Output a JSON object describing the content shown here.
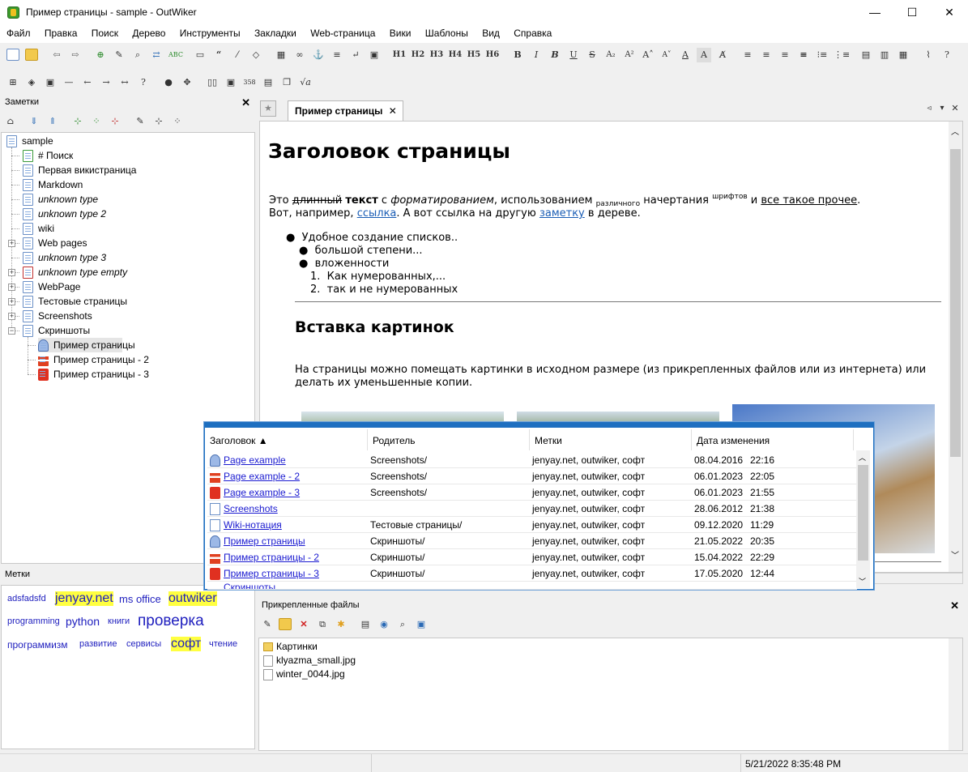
{
  "window": {
    "title": "Пример страницы - sample - OutWiker",
    "minimize": "—",
    "maximize": "☐",
    "close": "✕"
  },
  "menu": [
    "Файл",
    "Правка",
    "Поиск",
    "Дерево",
    "Инструменты",
    "Закладки",
    "Web-страница",
    "Вики",
    "Шаблоны",
    "Вид",
    "Справка"
  ],
  "toolbar": {
    "headings": [
      "H1",
      "H2",
      "H3",
      "H4",
      "H5",
      "H6"
    ],
    "sqrt": "√a"
  },
  "notes_panel": {
    "title": "Заметки",
    "root": "sample",
    "items": [
      {
        "label": "# Поиск",
        "italic": false
      },
      {
        "label": "Первая викистраница",
        "italic": false
      },
      {
        "label": "Markdown",
        "italic": false
      },
      {
        "label": "unknown type",
        "italic": true
      },
      {
        "label": "unknown type 2",
        "italic": true
      },
      {
        "label": "wiki",
        "italic": false
      },
      {
        "label": "Web pages",
        "italic": false
      },
      {
        "label": "unknown type 3",
        "italic": true
      },
      {
        "label": "unknown type empty",
        "italic": true
      },
      {
        "label": "WebPage",
        "italic": false
      },
      {
        "label": "Тестовые страницы",
        "italic": false
      },
      {
        "label": "Screenshots",
        "italic": false
      },
      {
        "label": "Скриншоты",
        "italic": false
      }
    ],
    "children": [
      "Пример страницы",
      "Пример страницы - 2",
      "Пример страницы - 3"
    ]
  },
  "tags_panel": {
    "title": "Метки",
    "tags": [
      "adsfadsfd",
      "jenyay.net",
      "ms office",
      "outwiker",
      "programming",
      "python",
      "книги",
      "проверка",
      "программизм",
      "развитие",
      "сервисы",
      "софт",
      "чтение"
    ]
  },
  "editor": {
    "tab_label": "Пример страницы",
    "heading": "Заголовок страницы",
    "p1": {
      "a": "Это ",
      "strike": "длинный",
      "bold": "текст",
      "b": " с ",
      "italic": "форматированием",
      "c": ", использованием ",
      "sub": "различного",
      "d": " начертания ",
      "sup": "шрифтов",
      "e": " и ",
      "under": "все такое прочее",
      "f": "."
    },
    "p2": {
      "a": "Вот, например, ",
      "link1": "ссылка",
      "b": ". А вот ссылка на другую ",
      "link2": "заметку",
      "c": " в дереве."
    },
    "list": [
      "Удобное создание списков..",
      "большой степени...",
      "вложенности",
      "Как нумерованных,...",
      "так и не нумерованных"
    ],
    "numbers": [
      "1.",
      "2."
    ],
    "heading2": "Вставка картинок",
    "p3a": "На страницы можно помещать картинки в исходном размере (из прикрепленных файлов или из интернета) или",
    "p3b": "делать их уменьшенные копии."
  },
  "popup": {
    "columns": [
      "Заголовок ▲",
      "Родитель",
      "Метки",
      "Дата изменения"
    ],
    "rows": [
      {
        "title": "Page example",
        "parent": "Screenshots/",
        "tags": "jenyay.net, outwiker, софт",
        "date": "08.04.2016",
        "time": "22:16",
        "icon": "user"
      },
      {
        "title": "Page example - 2",
        "parent": "Screenshots/",
        "tags": "jenyay.net, outwiker, софт",
        "date": "06.01.2023",
        "time": "22:05",
        "icon": "cone"
      },
      {
        "title": "Page example - 3",
        "parent": "Screenshots/",
        "tags": "jenyay.net, outwiker, софт",
        "date": "06.01.2023",
        "time": "21:55",
        "icon": "flag"
      },
      {
        "title": "Screenshots",
        "parent": "",
        "tags": "jenyay.net, outwiker, софт",
        "date": "28.06.2012",
        "time": "21:38",
        "icon": "page"
      },
      {
        "title": "Wiki-нотация",
        "parent": "Тестовые страницы/",
        "tags": "jenyay.net, outwiker, софт",
        "date": "09.12.2020",
        "time": "11:29",
        "icon": "page"
      },
      {
        "title": "Пример страницы",
        "parent": "Скриншоты/",
        "tags": "jenyay.net, outwiker, софт",
        "date": "21.05.2022",
        "time": "20:35",
        "icon": "user"
      },
      {
        "title": "Пример страницы - 2",
        "parent": "Скриншоты/",
        "tags": "jenyay.net, outwiker, софт",
        "date": "15.04.2022",
        "time": "22:29",
        "icon": "cone"
      },
      {
        "title": "Пример страницы - 3",
        "parent": "Скриншоты/",
        "tags": "jenyay.net, outwiker, софт",
        "date": "17.05.2020",
        "time": "12:44",
        "icon": "flag"
      }
    ]
  },
  "attachments": {
    "title": "Прикрепленные файлы",
    "files": [
      {
        "name": "Картинки",
        "folder": true
      },
      {
        "name": "klyazma_small.jpg",
        "folder": false
      },
      {
        "name": "winter_0044.jpg",
        "folder": false
      }
    ]
  },
  "status": {
    "datetime": "5/21/2022 8:35:48 PM"
  }
}
